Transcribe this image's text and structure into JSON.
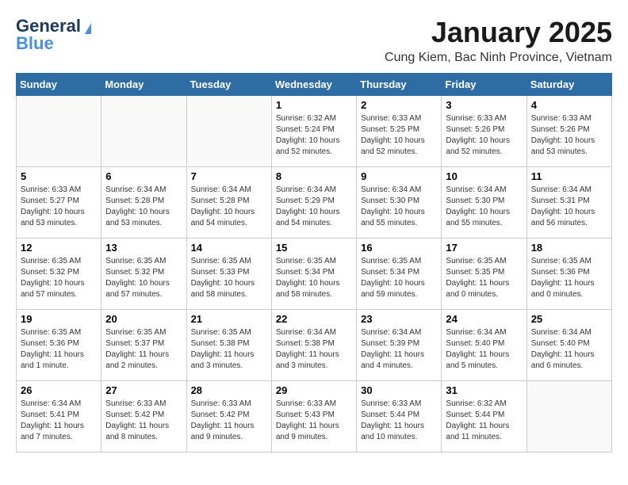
{
  "logo": {
    "line1": "General",
    "line2": "Blue"
  },
  "calendar": {
    "title": "January 2025",
    "subtitle": "Cung Kiem, Bac Ninh Province, Vietnam",
    "headers": [
      "Sunday",
      "Monday",
      "Tuesday",
      "Wednesday",
      "Thursday",
      "Friday",
      "Saturday"
    ],
    "weeks": [
      [
        {
          "day": "",
          "info": ""
        },
        {
          "day": "",
          "info": ""
        },
        {
          "day": "",
          "info": ""
        },
        {
          "day": "1",
          "info": "Sunrise: 6:32 AM\nSunset: 5:24 PM\nDaylight: 10 hours\nand 52 minutes."
        },
        {
          "day": "2",
          "info": "Sunrise: 6:33 AM\nSunset: 5:25 PM\nDaylight: 10 hours\nand 52 minutes."
        },
        {
          "day": "3",
          "info": "Sunrise: 6:33 AM\nSunset: 5:26 PM\nDaylight: 10 hours\nand 52 minutes."
        },
        {
          "day": "4",
          "info": "Sunrise: 6:33 AM\nSunset: 5:26 PM\nDaylight: 10 hours\nand 53 minutes."
        }
      ],
      [
        {
          "day": "5",
          "info": "Sunrise: 6:33 AM\nSunset: 5:27 PM\nDaylight: 10 hours\nand 53 minutes."
        },
        {
          "day": "6",
          "info": "Sunrise: 6:34 AM\nSunset: 5:28 PM\nDaylight: 10 hours\nand 53 minutes."
        },
        {
          "day": "7",
          "info": "Sunrise: 6:34 AM\nSunset: 5:28 PM\nDaylight: 10 hours\nand 54 minutes."
        },
        {
          "day": "8",
          "info": "Sunrise: 6:34 AM\nSunset: 5:29 PM\nDaylight: 10 hours\nand 54 minutes."
        },
        {
          "day": "9",
          "info": "Sunrise: 6:34 AM\nSunset: 5:30 PM\nDaylight: 10 hours\nand 55 minutes."
        },
        {
          "day": "10",
          "info": "Sunrise: 6:34 AM\nSunset: 5:30 PM\nDaylight: 10 hours\nand 55 minutes."
        },
        {
          "day": "11",
          "info": "Sunrise: 6:34 AM\nSunset: 5:31 PM\nDaylight: 10 hours\nand 56 minutes."
        }
      ],
      [
        {
          "day": "12",
          "info": "Sunrise: 6:35 AM\nSunset: 5:32 PM\nDaylight: 10 hours\nand 57 minutes."
        },
        {
          "day": "13",
          "info": "Sunrise: 6:35 AM\nSunset: 5:32 PM\nDaylight: 10 hours\nand 57 minutes."
        },
        {
          "day": "14",
          "info": "Sunrise: 6:35 AM\nSunset: 5:33 PM\nDaylight: 10 hours\nand 58 minutes."
        },
        {
          "day": "15",
          "info": "Sunrise: 6:35 AM\nSunset: 5:34 PM\nDaylight: 10 hours\nand 58 minutes."
        },
        {
          "day": "16",
          "info": "Sunrise: 6:35 AM\nSunset: 5:34 PM\nDaylight: 10 hours\nand 59 minutes."
        },
        {
          "day": "17",
          "info": "Sunrise: 6:35 AM\nSunset: 5:35 PM\nDaylight: 11 hours\nand 0 minutes."
        },
        {
          "day": "18",
          "info": "Sunrise: 6:35 AM\nSunset: 5:36 PM\nDaylight: 11 hours\nand 0 minutes."
        }
      ],
      [
        {
          "day": "19",
          "info": "Sunrise: 6:35 AM\nSunset: 5:36 PM\nDaylight: 11 hours\nand 1 minute."
        },
        {
          "day": "20",
          "info": "Sunrise: 6:35 AM\nSunset: 5:37 PM\nDaylight: 11 hours\nand 2 minutes."
        },
        {
          "day": "21",
          "info": "Sunrise: 6:35 AM\nSunset: 5:38 PM\nDaylight: 11 hours\nand 3 minutes."
        },
        {
          "day": "22",
          "info": "Sunrise: 6:34 AM\nSunset: 5:38 PM\nDaylight: 11 hours\nand 3 minutes."
        },
        {
          "day": "23",
          "info": "Sunrise: 6:34 AM\nSunset: 5:39 PM\nDaylight: 11 hours\nand 4 minutes."
        },
        {
          "day": "24",
          "info": "Sunrise: 6:34 AM\nSunset: 5:40 PM\nDaylight: 11 hours\nand 5 minutes."
        },
        {
          "day": "25",
          "info": "Sunrise: 6:34 AM\nSunset: 5:40 PM\nDaylight: 11 hours\nand 6 minutes."
        }
      ],
      [
        {
          "day": "26",
          "info": "Sunrise: 6:34 AM\nSunset: 5:41 PM\nDaylight: 11 hours\nand 7 minutes."
        },
        {
          "day": "27",
          "info": "Sunrise: 6:33 AM\nSunset: 5:42 PM\nDaylight: 11 hours\nand 8 minutes."
        },
        {
          "day": "28",
          "info": "Sunrise: 6:33 AM\nSunset: 5:42 PM\nDaylight: 11 hours\nand 9 minutes."
        },
        {
          "day": "29",
          "info": "Sunrise: 6:33 AM\nSunset: 5:43 PM\nDaylight: 11 hours\nand 9 minutes."
        },
        {
          "day": "30",
          "info": "Sunrise: 6:33 AM\nSunset: 5:44 PM\nDaylight: 11 hours\nand 10 minutes."
        },
        {
          "day": "31",
          "info": "Sunrise: 6:32 AM\nSunset: 5:44 PM\nDaylight: 11 hours\nand 11 minutes."
        },
        {
          "day": "",
          "info": ""
        }
      ]
    ]
  }
}
